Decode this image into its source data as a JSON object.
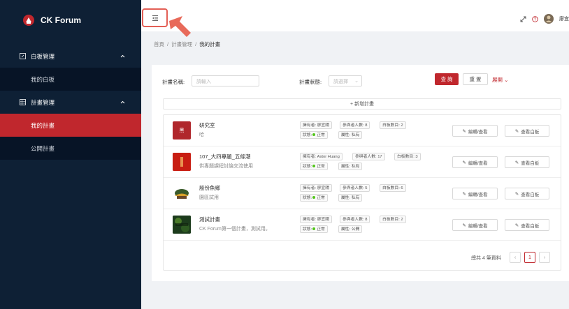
{
  "brand": {
    "name": "CK Forum"
  },
  "sidebar": {
    "groups": [
      {
        "label": "白板管理",
        "items": [
          {
            "label": "我的白板"
          }
        ]
      },
      {
        "label": "計畫管理",
        "items": [
          {
            "label": "我的計畫"
          },
          {
            "label": "公開計畫"
          }
        ]
      }
    ]
  },
  "header": {
    "user": "廖宜"
  },
  "breadcrumb": [
    "首頁",
    "計畫管理",
    "我的計畫"
  ],
  "filter": {
    "name_label": "計畫名稱:",
    "name_placeholder": "請輸入",
    "status_label": "計畫狀態:",
    "status_placeholder": "請選擇",
    "search": "查 詢",
    "reset": "重 置",
    "expand": "展開"
  },
  "new_plan": "+ 新增計畫",
  "plans": [
    {
      "title": "研究室",
      "desc": "哈",
      "owner": "擁有者: 廖宜陽",
      "members": "參與者人數: 8",
      "boards": "白板數目: 2",
      "status": "正常",
      "attr": "屬性: 私有",
      "thumb": "黑"
    },
    {
      "title": "107_大四專題_五條潮",
      "desc": "供專題課程討論交流使用",
      "owner": "擁有者: Astor Huang",
      "members": "參與者人數: 17",
      "boards": "白板數目: 3",
      "status": "正常",
      "attr": "屬性: 私有",
      "thumb": ""
    },
    {
      "title": "殷份魚鄉",
      "desc": "園區試用",
      "owner": "擁有者: 廖宜陽",
      "members": "參與者人數: 5",
      "boards": "白板數目: 6",
      "status": "正常",
      "attr": "屬性: 私有",
      "thumb": ""
    },
    {
      "title": "測試計畫",
      "desc": "CK Forum第一個計畫，測試用。",
      "owner": "擁有者: 廖宜陽",
      "members": "參與者人數: 8",
      "boards": "白板數目: 2",
      "status": "正常",
      "attr": "屬性: 公開",
      "thumb": ""
    }
  ],
  "status_prefix": "狀態:",
  "actions": {
    "edit": "編輯/查看",
    "view_board": "查看白板"
  },
  "pagination": {
    "total": "總共 4 筆資料",
    "current": "1"
  },
  "colors": {
    "sidebar": "#0e2035",
    "accent": "#c0272d",
    "active_green": "#52c41a"
  }
}
